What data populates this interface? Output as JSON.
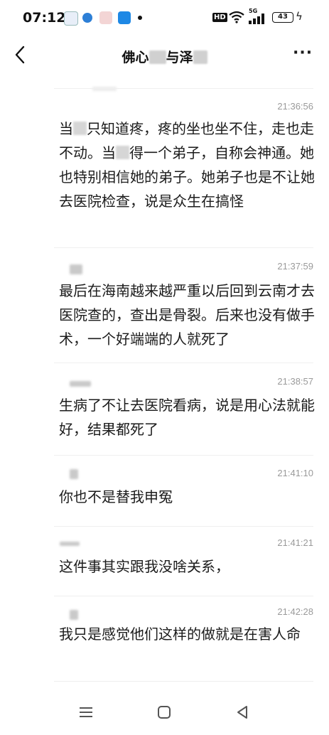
{
  "status_bar": {
    "time": "07:12",
    "hd": "HD",
    "net": "5G",
    "battery": "43"
  },
  "header": {
    "title_part1": "佛心",
    "title_part2": "与泽"
  },
  "messages": [
    {
      "time": "21:36:56",
      "seg": [
        "当",
        "只知道疼，疼的坐也坐不住，走也走不动。当",
        "得一个弟子，自称会神通。她也特别相信她的弟子。她弟子也是不让她去医院检查，说是众生在搞怪"
      ]
    },
    {
      "time": "21:37:59",
      "text": "最后在海南越来越严重以后回到云南才去医院查的，查出是骨裂。后来也没有做手术，一个好端端的人就死了"
    },
    {
      "time": "21:38:57",
      "text": "生病了不让去医院看病，说是用心法就能好，结果都死了"
    },
    {
      "time": "21:41:10",
      "text": "你也不是替我申冤"
    },
    {
      "time": "21:41:21",
      "text": "这件事其实跟我没啥关系，"
    },
    {
      "time": "21:42:28",
      "text": "我只是感觉他们这样的做就是在害人命"
    }
  ]
}
